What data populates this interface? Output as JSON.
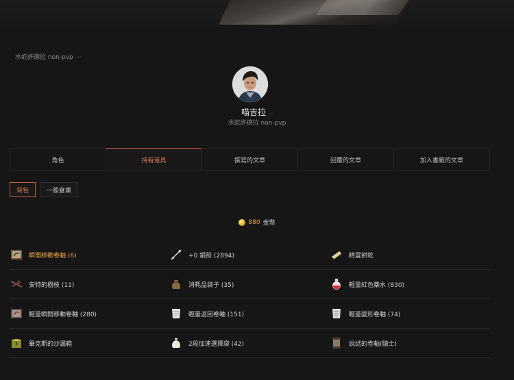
{
  "server_selector": {
    "label": "水蛇許德拉 non-pvp"
  },
  "profile": {
    "name": "喵吉拉",
    "server": "水蛇許德拉 non-pvp"
  },
  "tabs": [
    {
      "label": "角色"
    },
    {
      "label": "持有道具"
    },
    {
      "label": "撰寫的文章"
    },
    {
      "label": "回覆的文章"
    },
    {
      "label": "加入書籤的文章"
    }
  ],
  "subtabs": [
    {
      "label": "背包"
    },
    {
      "label": "一般倉庫"
    }
  ],
  "gold": {
    "amount": "880",
    "unit": "金幣"
  },
  "items": [
    {
      "label": "瞬間移動卷軸 (6)",
      "icon": "scroll-icon",
      "highlight": true
    },
    {
      "label": "+0 銀箭 (2894)",
      "icon": "arrow-icon"
    },
    {
      "label": "精靈餅乾",
      "icon": "cookie-icon"
    },
    {
      "label": "安特的樹枝 (11)",
      "icon": "branch-icon"
    },
    {
      "label": "消耗品袋子 (35)",
      "icon": "pouch-icon"
    },
    {
      "label": "輕量紅色藥水 (830)",
      "icon": "potion-icon"
    },
    {
      "label": "輕量瞬間移動卷軸 (280)",
      "icon": "scroll-icon"
    },
    {
      "label": "輕量返回卷軸 (151)",
      "icon": "paper-scroll-icon"
    },
    {
      "label": "輕量變形卷軸 (74)",
      "icon": "paper-scroll-icon"
    },
    {
      "label": "畢克斯的沙漏箱",
      "icon": "chest-icon"
    },
    {
      "label": "2段加速選擇袋 (42)",
      "icon": "sack-icon"
    },
    {
      "label": "說話的卷軸(騎士)",
      "icon": "talking-scroll-icon"
    }
  ]
}
